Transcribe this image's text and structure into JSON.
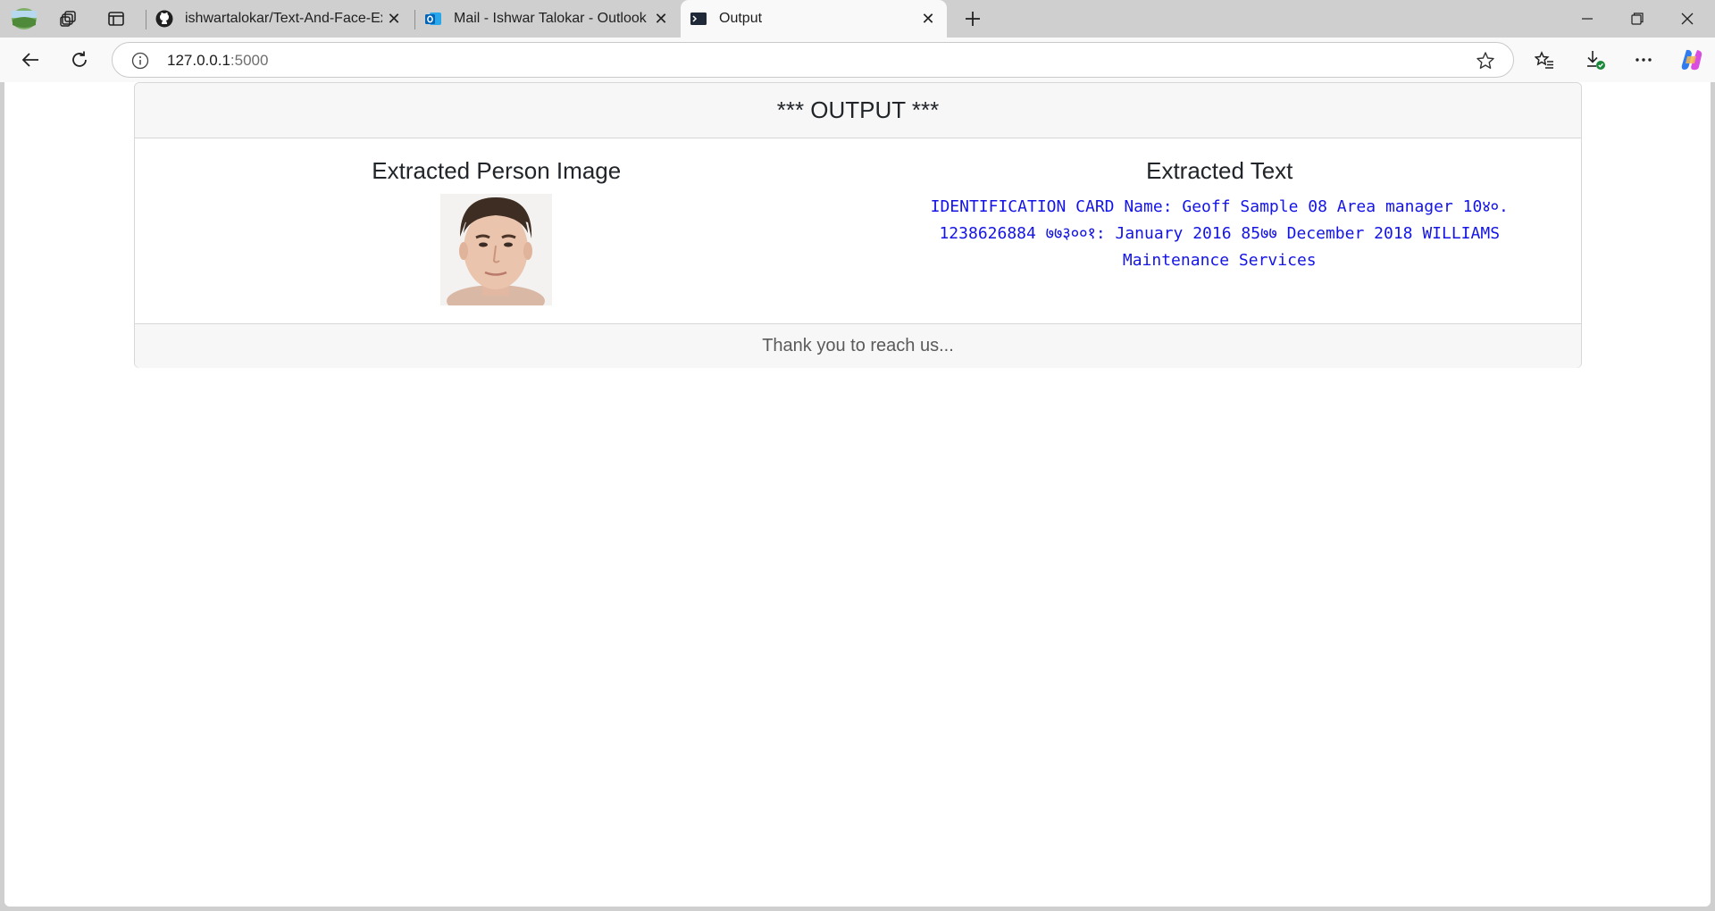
{
  "browser": {
    "tabs": [
      {
        "label": "ishwartalokar/Text-And-Face-Extr",
        "icon": "github-icon",
        "active": false
      },
      {
        "label": "Mail - Ishwar Talokar - Outlook",
        "icon": "outlook-icon",
        "active": false
      },
      {
        "label": "Output",
        "icon": "terminal-icon",
        "active": true
      }
    ],
    "address": {
      "host": "127.0.0.1",
      "port": ":5000"
    }
  },
  "page": {
    "header": "*** OUTPUT ***",
    "left_heading": "Extracted Person Image",
    "right_heading": "Extracted Text",
    "extracted_text": "IDENTIFICATION CARD Name: Geoff Sample 08 Area manager 10४०. 1238626884 ७७३००१: January 2016 85७७ December 2018 WILLIAMS Maintenance Services",
    "footer": "Thank you to reach us..."
  },
  "colors": {
    "extracted_text": "#1414e6",
    "active_tab": "#f9f9f9"
  }
}
